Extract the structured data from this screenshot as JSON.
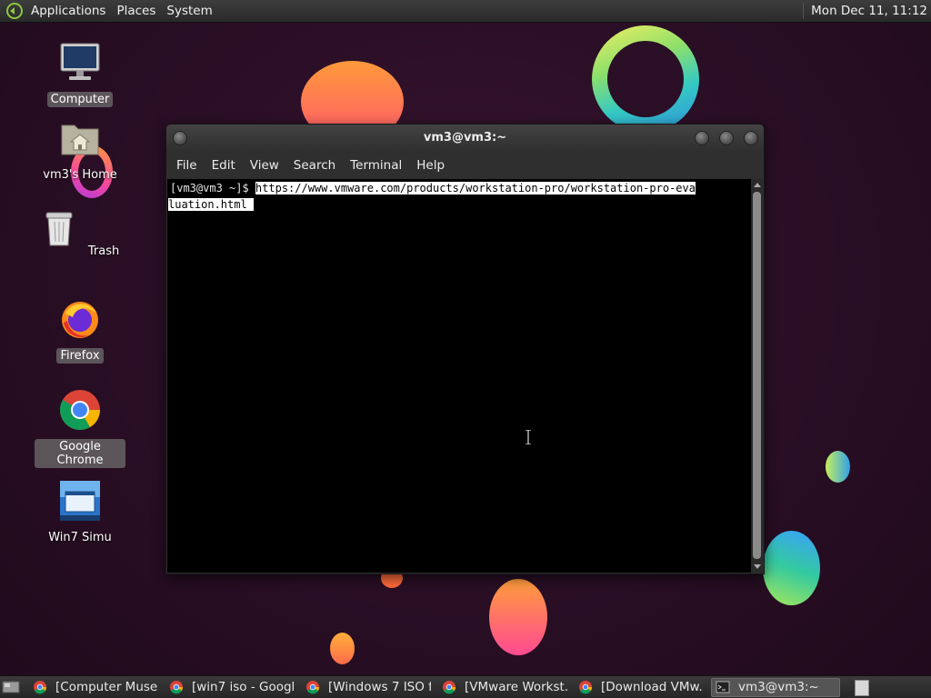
{
  "top_panel": {
    "menus": [
      "Applications",
      "Places",
      "System"
    ],
    "clock": "Mon Dec 11, 11:12"
  },
  "desktop_icons": [
    {
      "label": "Computer",
      "icon": "computer-icon"
    },
    {
      "label": "vm3's Home",
      "icon": "home-folder-icon"
    },
    {
      "label": "Trash",
      "icon": "trash-icon"
    },
    {
      "label": "Firefox",
      "icon": "firefox-icon"
    },
    {
      "label": "Google Chrome",
      "icon": "chrome-icon"
    },
    {
      "label": "Win7 Simu",
      "icon": "win7-icon"
    }
  ],
  "terminal": {
    "title": "vm3@vm3:~",
    "menu": [
      "File",
      "Edit",
      "View",
      "Search",
      "Terminal",
      "Help"
    ],
    "prompt": "[vm3@vm3 ~]$ ",
    "selected_line_1": "https://www.vmware.com/products/workstation-pro/workstation-pro-eva",
    "selected_line_2": "luation.html "
  },
  "taskbar": {
    "tasks": [
      {
        "label": "[Computer Muse...",
        "icon": "chrome-icon"
      },
      {
        "label": "[win7 iso - Googl...",
        "icon": "chrome-icon"
      },
      {
        "label": "[Windows 7 ISO f...",
        "icon": "chrome-icon"
      },
      {
        "label": "[VMware Workst...",
        "icon": "chrome-icon"
      },
      {
        "label": "[Download VMw...",
        "icon": "chrome-icon"
      },
      {
        "label": "vm3@vm3:~",
        "icon": "terminal-icon"
      }
    ]
  },
  "colors": {
    "wallpaper": "#2b0f26",
    "panel": "#2f2f2f",
    "terminal_bg": "#000000",
    "selection_bg": "#ffffff"
  }
}
